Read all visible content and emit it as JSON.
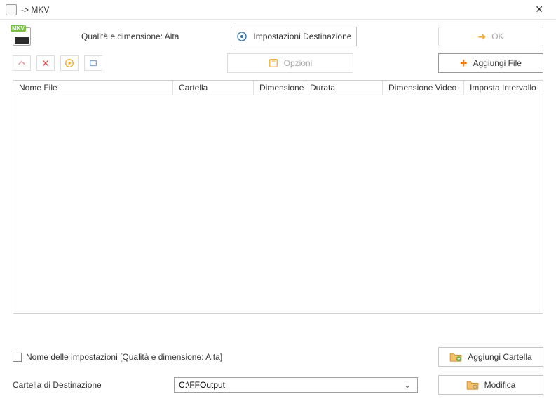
{
  "window": {
    "title": "-> MKV"
  },
  "top": {
    "mkv_tag": "MKV",
    "quality_label": "Qualità e dimensione: Alta",
    "dest_settings": "Impostazioni Destinazione",
    "ok": "OK",
    "options": "Opzioni",
    "add_file": "Aggiungi File"
  },
  "columns": {
    "c0": "Nome File",
    "c1": "Cartella",
    "c2": "Dimensione",
    "c3": "Durata",
    "c4": "Dimensione Video",
    "c5": "Imposta Intervallo"
  },
  "bottom": {
    "settings_name_label": "Nome delle impostazioni [Qualità e dimensione: Alta]",
    "add_folder": "Aggiungi Cartella",
    "dest_folder_label": "Cartella di Destinazione",
    "dest_folder_value": "C:\\FFOutput",
    "modify": "Modifica"
  }
}
